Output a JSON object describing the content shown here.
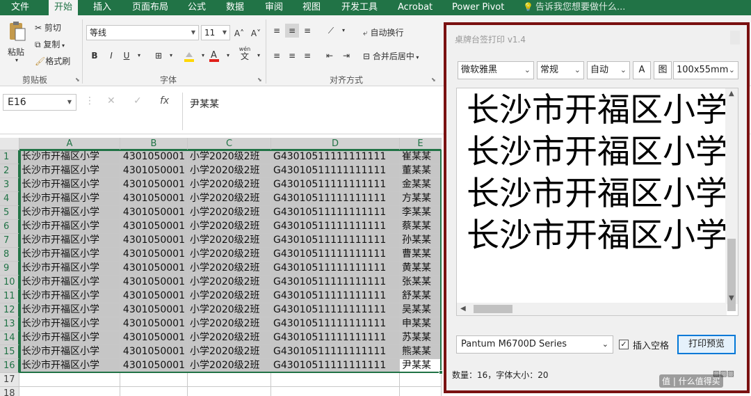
{
  "ribbon_tabs": [
    "文件",
    "开始",
    "插入",
    "页面布局",
    "公式",
    "数据",
    "审阅",
    "视图",
    "开发工具",
    "Acrobat",
    "Power Pivot"
  ],
  "tell_me": "告诉我您想要做什么...",
  "clipboard": {
    "paste": "粘贴",
    "cut": "剪切",
    "copy": "复制",
    "format_painter": "格式刷",
    "group": "剪贴板"
  },
  "font": {
    "name": "等线",
    "size": "11",
    "grow": "A˄",
    "shrink": "A˅",
    "bold": "B",
    "italic": "I",
    "underline": "U",
    "wen": "wén",
    "group": "字体"
  },
  "alignment": {
    "wrap": "自动换行",
    "merge": "合并后居中",
    "group": "对齐方式"
  },
  "name_box": "E16",
  "formula_value": "尹某某",
  "columns": [
    "A",
    "B",
    "C",
    "D",
    "E"
  ],
  "rows": [
    {
      "n": "1",
      "a": "长沙市开福区小学",
      "b": "4301050001",
      "c": "小学2020级2班",
      "d": "G43010511111111111",
      "e": "崔某某"
    },
    {
      "n": "2",
      "a": "长沙市开福区小学",
      "b": "4301050001",
      "c": "小学2020级2班",
      "d": "G43010511111111111",
      "e": "董某某"
    },
    {
      "n": "3",
      "a": "长沙市开福区小学",
      "b": "4301050001",
      "c": "小学2020级2班",
      "d": "G43010511111111111",
      "e": "金某某"
    },
    {
      "n": "4",
      "a": "长沙市开福区小学",
      "b": "4301050001",
      "c": "小学2020级2班",
      "d": "G43010511111111111",
      "e": "方某某"
    },
    {
      "n": "5",
      "a": "长沙市开福区小学",
      "b": "4301050001",
      "c": "小学2020级2班",
      "d": "G43010511111111111",
      "e": "李某某"
    },
    {
      "n": "6",
      "a": "长沙市开福区小学",
      "b": "4301050001",
      "c": "小学2020级2班",
      "d": "G43010511111111111",
      "e": "蔡某某"
    },
    {
      "n": "7",
      "a": "长沙市开福区小学",
      "b": "4301050001",
      "c": "小学2020级2班",
      "d": "G43010511111111111",
      "e": "孙某某"
    },
    {
      "n": "8",
      "a": "长沙市开福区小学",
      "b": "4301050001",
      "c": "小学2020级2班",
      "d": "G43010511111111111",
      "e": "曹某某"
    },
    {
      "n": "9",
      "a": "长沙市开福区小学",
      "b": "4301050001",
      "c": "小学2020级2班",
      "d": "G43010511111111111",
      "e": "黄某某"
    },
    {
      "n": "10",
      "a": "长沙市开福区小学",
      "b": "4301050001",
      "c": "小学2020级2班",
      "d": "G43010511111111111",
      "e": "张某某"
    },
    {
      "n": "11",
      "a": "长沙市开福区小学",
      "b": "4301050001",
      "c": "小学2020级2班",
      "d": "G43010511111111111",
      "e": "舒某某"
    },
    {
      "n": "12",
      "a": "长沙市开福区小学",
      "b": "4301050001",
      "c": "小学2020级2班",
      "d": "G43010511111111111",
      "e": "吴某某"
    },
    {
      "n": "13",
      "a": "长沙市开福区小学",
      "b": "4301050001",
      "c": "小学2020级2班",
      "d": "G43010511111111111",
      "e": "申某某"
    },
    {
      "n": "14",
      "a": "长沙市开福区小学",
      "b": "4301050001",
      "c": "小学2020级2班",
      "d": "G43010511111111111",
      "e": "苏某某"
    },
    {
      "n": "15",
      "a": "长沙市开福区小学",
      "b": "4301050001",
      "c": "小学2020级2班",
      "d": "G43010511111111111",
      "e": "熊某某"
    },
    {
      "n": "16",
      "a": "长沙市开福区小学",
      "b": "4301050001",
      "c": "小学2020级2班",
      "d": "G43010511111111111",
      "e": "尹某某"
    }
  ],
  "extra_rows": [
    "17",
    "18"
  ],
  "panel": {
    "title": "桌牌台签打印 v1.4",
    "font_select": "微软雅黑",
    "style_select": "常规",
    "size_select": "自动",
    "btn_a": "A",
    "btn_img": "图",
    "paper_select": "100x55mm",
    "preview_lines": [
      "长沙市开福区小学",
      "长沙市开福区小学",
      "长沙市开福区小学",
      "长沙市开福区小学"
    ],
    "printer": "Pantum M6700D Series",
    "insert_space_checked": true,
    "insert_space_label": "插入空格",
    "preview_button": "打印预览",
    "status": "数量：16，字体大小：20"
  },
  "watermark": "值 | 什么值得买",
  "accent_colors": {
    "excel_green": "#217346",
    "panel_border": "#7a1111"
  }
}
